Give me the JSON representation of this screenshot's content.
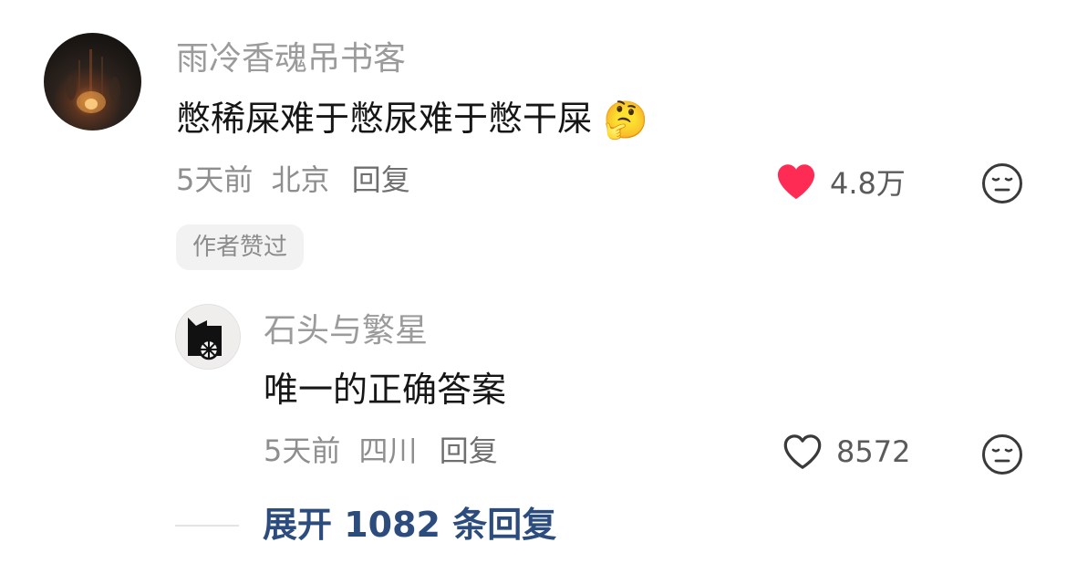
{
  "comment": {
    "author": "雨冷香魂吊书客",
    "text": "憋稀屎难于憋尿难于憋干屎",
    "emoji": "🤔",
    "time": "5天前",
    "location": "北京",
    "reply_label": "回复",
    "likes": "4.8万",
    "liked": true,
    "badge": "作者赞过"
  },
  "reply": {
    "author": "石头与繁星",
    "text": "唯一的正确答案",
    "time": "5天前",
    "location": "四川",
    "reply_label": "回复",
    "likes": "8572",
    "liked": false
  },
  "expand": {
    "label": "展开 1082 条回复"
  },
  "colors": {
    "like_active": "#fe2c55",
    "link": "#2d4c7e",
    "muted_text": "#9b9b9b"
  },
  "icons": {
    "like_active": "heart-filled-icon",
    "like_inactive": "heart-outline-icon",
    "dislike": "neutral-face-icon"
  }
}
